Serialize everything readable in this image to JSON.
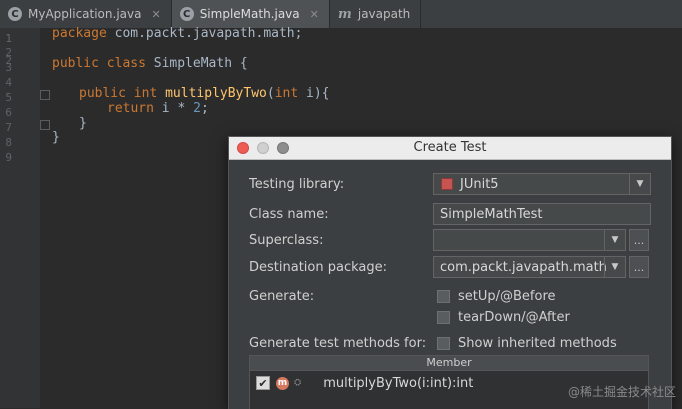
{
  "tabs": [
    {
      "icon": "C",
      "label": "MyApplication.java",
      "active": false
    },
    {
      "icon": "C",
      "label": "SimpleMath.java",
      "active": true
    },
    {
      "icon": "m",
      "label": "javapath",
      "active": false
    }
  ],
  "editor": {
    "line_numbers": [
      "1",
      "2",
      "3",
      "4",
      "5",
      "6",
      "7",
      "8",
      "9"
    ],
    "lines": [
      {
        "kw": "package",
        "rest": " com.packt.javapath.math;"
      },
      {
        "kw": "",
        "rest": ""
      },
      {
        "kw": "public class",
        "rest": " SimpleMath {"
      },
      {
        "kw": "",
        "rest": ""
      },
      {
        "kw": "public int",
        "fn": "multiplyByTwo",
        "kw2": "int",
        "rest": "("
      },
      {
        "kw": "return",
        "rest": " i * ",
        "num": "2"
      },
      {
        "kw": "",
        "rest": "}"
      },
      {
        "kw": "",
        "rest": "}"
      }
    ],
    "line5_tail": " i){",
    "line6_tail": ";"
  },
  "dialog": {
    "title": "Create Test",
    "testing_library_label": "Testing library:",
    "testing_library_value": "JUnit5",
    "class_name_label": "Class name:",
    "class_name_value": "SimpleMathTest",
    "superclass_label": "Superclass:",
    "superclass_value": "",
    "destination_label": "Destination package:",
    "destination_value": "com.packt.javapath.math",
    "generate_label": "Generate:",
    "generate_options": [
      "setUp/@Before",
      "tearDown/@After"
    ],
    "methods_for_label": "Generate test methods for:",
    "show_inherited_label": "Show inherited methods",
    "table_header": "Member",
    "member_icon": "m",
    "member_visibility": "⛭",
    "member": "multiplyByTwo(i:int):int",
    "browse_label": "..."
  },
  "watermark": "@稀土掘金技术社区",
  "colors": {
    "keyword": "#cc7832",
    "function": "#ffc66d",
    "number": "#6897bb",
    "editor_bg": "#2b2b2b",
    "dialog_bg": "#3c3f41"
  }
}
